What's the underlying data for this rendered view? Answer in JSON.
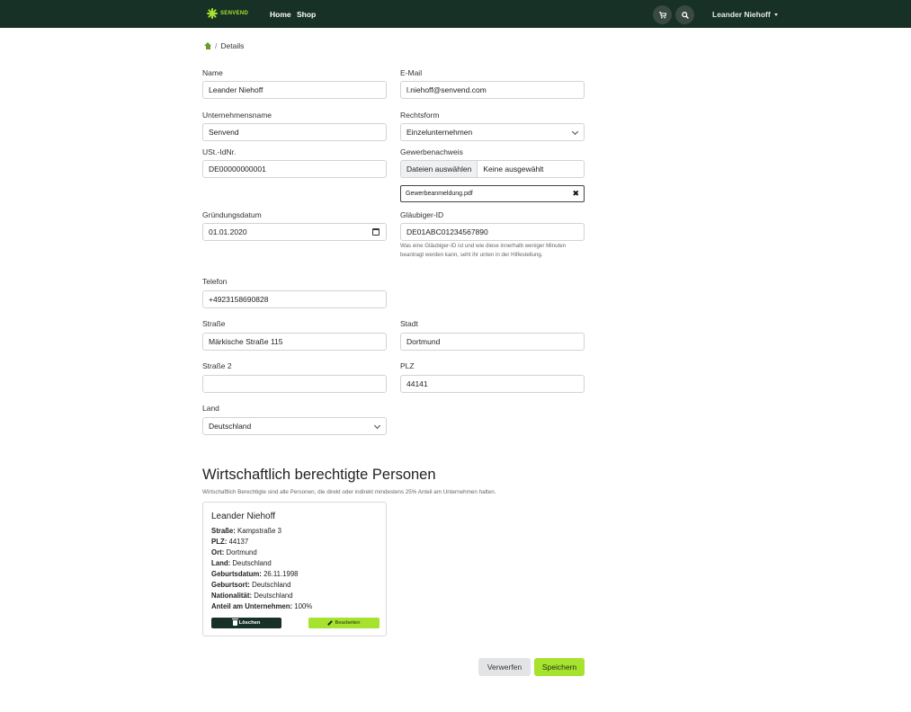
{
  "navbar": {
    "brand": "SENVEND",
    "links": [
      "Home",
      "Shop"
    ],
    "user": "Leander Niehoff",
    "icons": {
      "cart": "cart-icon",
      "search": "search-icon"
    }
  },
  "breadcrumb": {
    "current": "Details",
    "separator": "/"
  },
  "form": {
    "name": {
      "label": "Name",
      "value": "Leander Niehoff"
    },
    "email": {
      "label": "E-Mail",
      "value": "l.niehoff@senvend.com"
    },
    "company": {
      "label": "Unternehmensname",
      "value": "Senvend"
    },
    "legal_form": {
      "label": "Rechtsform",
      "value": "Einzelunternehmen"
    },
    "vat_id": {
      "label": "USt.-IdNr.",
      "value": "DE00000000001"
    },
    "trade_license": {
      "label": "Gewerbenachweis",
      "button": "Dateien auswählen",
      "status": "Keine ausgewählt",
      "file": "Gewerbeanmeldung.pdf"
    },
    "founding_date": {
      "label": "Gründungsdatum",
      "value": "01.01.2020"
    },
    "creditor_id": {
      "label": "Gläubiger-ID",
      "value": "DE01ABC01234567890",
      "help": "Was eine Gläubiger-ID ist und wie diese innerhalb weniger Minuten beantragt werden kann, seht ihr unten in der Hilfestellung."
    },
    "phone": {
      "label": "Telefon",
      "value": "+4923158690828"
    },
    "street": {
      "label": "Straße",
      "value": "Märkische Straße 115"
    },
    "city": {
      "label": "Stadt",
      "value": "Dortmund"
    },
    "street2": {
      "label": "Straße 2",
      "value": ""
    },
    "zip": {
      "label": "PLZ",
      "value": "44141"
    },
    "country": {
      "label": "Land",
      "value": "Deutschland"
    }
  },
  "beneficiaries": {
    "title": "Wirtschaftlich berechtigte Personen",
    "description": "Wirtschaftlich Berechtigte sind alle Personen, die direkt oder indirekt mindestens 25% Anteil am Unternehmen halten.",
    "person": {
      "name": "Leander Niehoff",
      "rows": [
        {
          "key": "Straße:",
          "value": "Kampstraße 3"
        },
        {
          "key": "PLZ:",
          "value": "44137"
        },
        {
          "key": "Ort:",
          "value": "Dortmund"
        },
        {
          "key": "Land:",
          "value": "Deutschland"
        },
        {
          "key": "Geburtsdatum:",
          "value": "26.11.1998"
        },
        {
          "key": "Geburtsort:",
          "value": "Deutschland"
        },
        {
          "key": "Nationalität:",
          "value": "Deutschland"
        },
        {
          "key": "Anteil am Unternehmen:",
          "value": "100%"
        }
      ],
      "delete_label": "Löschen",
      "edit_label": "Bearbeiten"
    }
  },
  "actions": {
    "discard": "Verwerfen",
    "save": "Speichern"
  },
  "colors": {
    "navbar": "#173126",
    "accent": "#a6e22e"
  }
}
